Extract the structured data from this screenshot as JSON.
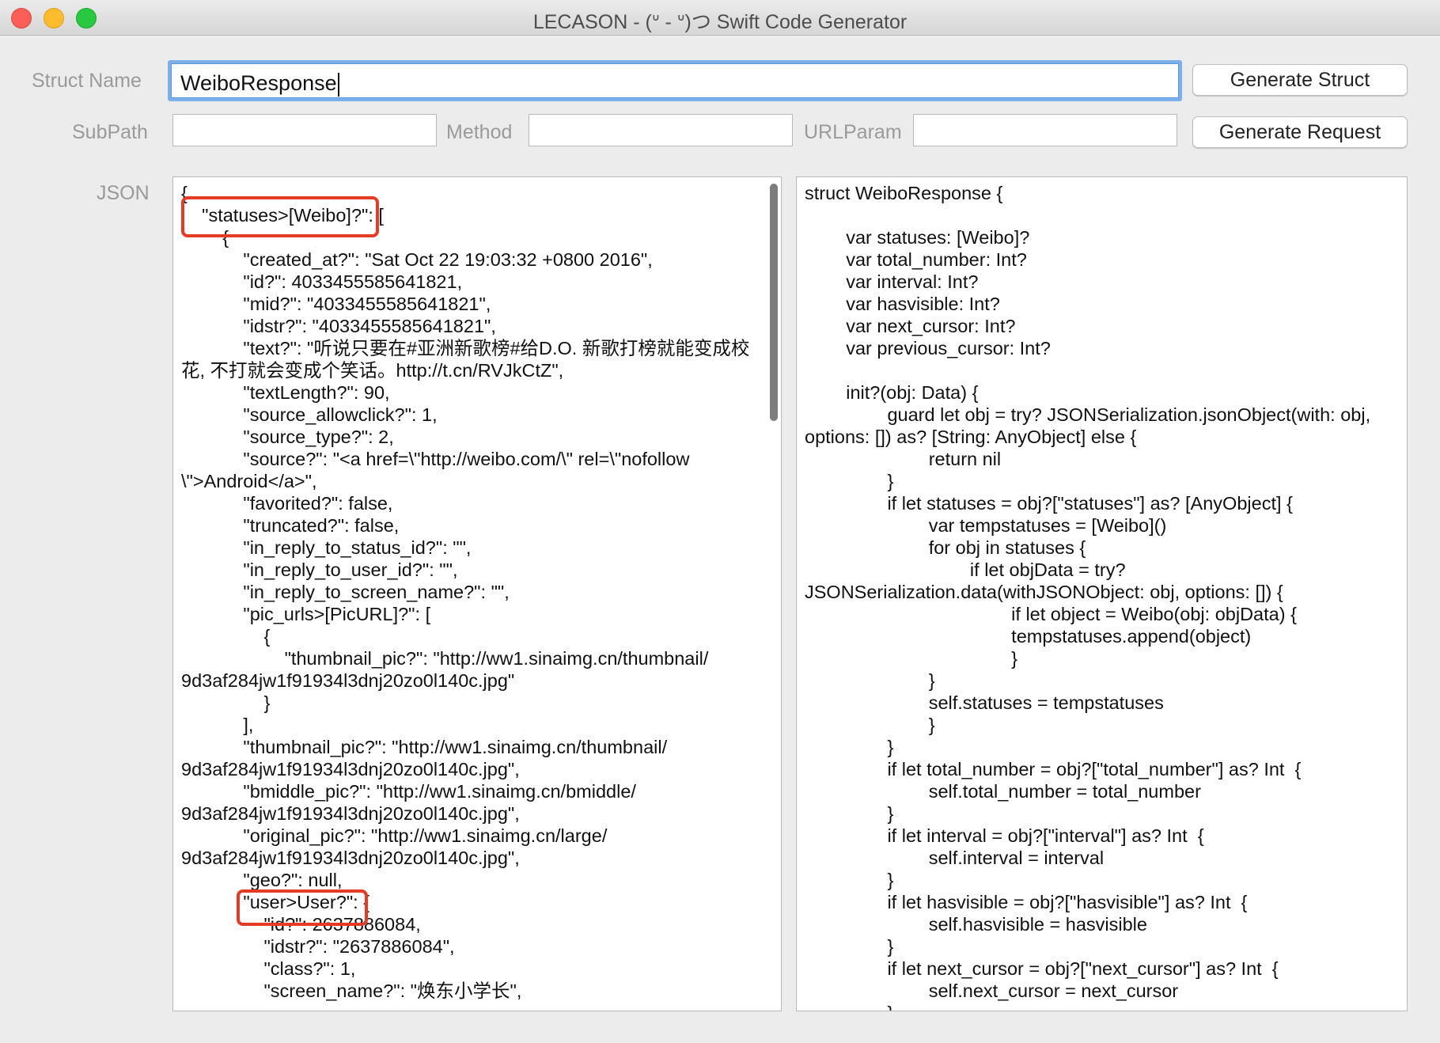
{
  "window": {
    "title": "LECASON - (ᐡ - ᐡ)つ Swift Code Generator"
  },
  "form": {
    "struct_name_label": "Struct Name",
    "struct_name_value": "WeiboResponse",
    "generate_struct_label": "Generate Struct",
    "subpath_label": "SubPath",
    "subpath_value": "",
    "method_label": "Method",
    "method_value": "",
    "urlparam_label": "URLParam",
    "urlparam_value": "",
    "generate_request_label": "Generate Request",
    "json_label": "JSON"
  },
  "json_input": {
    "lines": [
      "{",
      "    \"statuses>[Weibo]?\": [",
      "        {",
      "            \"created_at?\": \"Sat Oct 22 19:03:32 +0800 2016\",",
      "            \"id?\": 4033455585641821,",
      "            \"mid?\": \"4033455585641821\",",
      "            \"idstr?\": \"4033455585641821\",",
      "            \"text?\": \"听说只要在#亚洲新歌榜#给D.O. 新歌打榜就能变成校",
      "花, 不打就会变成个笑话。http://t.cn/RVJkCtZ\",",
      "            \"textLength?\": 90,",
      "            \"source_allowclick?\": 1,",
      "            \"source_type?\": 2,",
      "            \"source?\": \"<a href=\\\"http://weibo.com/\\\" rel=\\\"nofollow",
      "\\\">Android</a>\",",
      "            \"favorited?\": false,",
      "            \"truncated?\": false,",
      "            \"in_reply_to_status_id?\": \"\",",
      "            \"in_reply_to_user_id?\": \"\",",
      "            \"in_reply_to_screen_name?\": \"\",",
      "            \"pic_urls>[PicURL]?\": [",
      "                {",
      "                    \"thumbnail_pic?\": \"http://ww1.sinaimg.cn/thumbnail/",
      "9d3af284jw1f91934l3dnj20zo0l140c.jpg\"",
      "                }",
      "            ],",
      "            \"thumbnail_pic?\": \"http://ww1.sinaimg.cn/thumbnail/",
      "9d3af284jw1f91934l3dnj20zo0l140c.jpg\",",
      "            \"bmiddle_pic?\": \"http://ww1.sinaimg.cn/bmiddle/",
      "9d3af284jw1f91934l3dnj20zo0l140c.jpg\",",
      "            \"original_pic?\": \"http://ww1.sinaimg.cn/large/",
      "9d3af284jw1f91934l3dnj20zo0l140c.jpg\",",
      "            \"geo?\": null,",
      "            \"user>User?\": {",
      "                \"id?\": 2637886084,",
      "                \"idstr?\": \"2637886084\",",
      "                \"class?\": 1,",
      "                \"screen_name?\": \"焕东小学长\","
    ]
  },
  "swift_output": {
    "lines": [
      "struct WeiboResponse {",
      "",
      "        var statuses: [Weibo]?",
      "        var total_number: Int?",
      "        var interval: Int?",
      "        var hasvisible: Int?",
      "        var next_cursor: Int?",
      "        var previous_cursor: Int?",
      "",
      "        init?(obj: Data) {",
      "                guard let obj = try? JSONSerialization.jsonObject(with: obj,",
      "options: []) as? [String: AnyObject] else {",
      "                        return nil",
      "                }",
      "                if let statuses = obj?[\"statuses\"] as? [AnyObject] {",
      "                        var tempstatuses = [Weibo]()",
      "                        for obj in statuses {",
      "                                if let objData = try?",
      "JSONSerialization.data(withJSONObject: obj, options: []) {",
      "                                        if let object = Weibo(obj: objData) {",
      "                                        tempstatuses.append(object)",
      "                                        }",
      "                        }",
      "                        self.statuses = tempstatuses",
      "                        }",
      "                }",
      "                if let total_number = obj?[\"total_number\"] as? Int  {",
      "                        self.total_number = total_number",
      "                }",
      "                if let interval = obj?[\"interval\"] as? Int  {",
      "                        self.interval = interval",
      "                }",
      "                if let hasvisible = obj?[\"hasvisible\"] as? Int  {",
      "                        self.hasvisible = hasvisible",
      "                }",
      "                if let next_cursor = obj?[\"next_cursor\"] as? Int  {",
      "                        self.next_cursor = next_cursor",
      "                }"
    ]
  },
  "colors": {
    "highlight_box": "#e53a24",
    "focus_ring": "#7bb0ea"
  }
}
